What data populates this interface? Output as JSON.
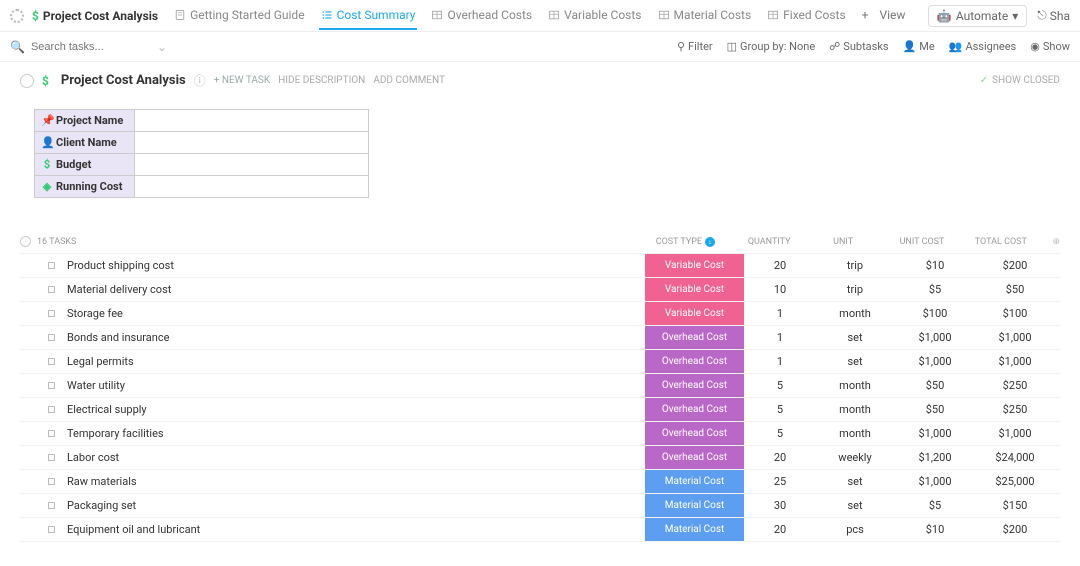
{
  "topbar": {
    "workspace_title": "Project Cost Analysis",
    "tabs": [
      {
        "label": "Getting Started Guide",
        "type": "doc"
      },
      {
        "label": "Cost Summary",
        "type": "list",
        "active": true
      },
      {
        "label": "Overhead Costs",
        "type": "table"
      },
      {
        "label": "Variable Costs",
        "type": "table"
      },
      {
        "label": "Material Costs",
        "type": "table"
      },
      {
        "label": "Fixed Costs",
        "type": "table"
      }
    ],
    "view_label": "View",
    "automate_label": "Automate",
    "share_label": "Sha"
  },
  "toolbar": {
    "search_placeholder": "Search tasks...",
    "filter": "Filter",
    "groupby": "Group by: None",
    "subtasks": "Subtasks",
    "me": "Me",
    "assignees": "Assignees",
    "show": "Show"
  },
  "page": {
    "title": "Project Cost Analysis",
    "new_task": "+ NEW TASK",
    "hide_desc": "HIDE DESCRIPTION",
    "add_comment": "ADD COMMENT",
    "show_closed": "SHOW CLOSED"
  },
  "fields": [
    {
      "icon": "📌",
      "icon_color": "#e74c3c",
      "label": "Project Name"
    },
    {
      "icon": "👤",
      "icon_color": "#d35400",
      "label": "Client Name"
    },
    {
      "icon": "$",
      "icon_color": "#2ecc71",
      "label": "Budget"
    },
    {
      "icon": "◈",
      "icon_color": "#2ecc71",
      "label": "Running Cost"
    }
  ],
  "table": {
    "count_label": "16 TASKS",
    "columns": {
      "cost_type": "COST TYPE",
      "quantity": "QUANTITY",
      "unit": "UNIT",
      "unit_cost": "UNIT COST",
      "total_cost": "TOTAL COST"
    },
    "rows": [
      {
        "name": "Product shipping cost",
        "cost_type": "Variable Cost",
        "type_class": "variable",
        "qty": "20",
        "unit": "trip",
        "unit_cost": "$10",
        "total": "$200"
      },
      {
        "name": "Material delivery cost",
        "cost_type": "Variable Cost",
        "type_class": "variable",
        "qty": "10",
        "unit": "trip",
        "unit_cost": "$5",
        "total": "$50"
      },
      {
        "name": "Storage fee",
        "cost_type": "Variable Cost",
        "type_class": "variable",
        "qty": "1",
        "unit": "month",
        "unit_cost": "$100",
        "total": "$100"
      },
      {
        "name": "Bonds and insurance",
        "cost_type": "Overhead Cost",
        "type_class": "overhead",
        "qty": "1",
        "unit": "set",
        "unit_cost": "$1,000",
        "total": "$1,000"
      },
      {
        "name": "Legal permits",
        "cost_type": "Overhead Cost",
        "type_class": "overhead",
        "qty": "1",
        "unit": "set",
        "unit_cost": "$1,000",
        "total": "$1,000"
      },
      {
        "name": "Water utility",
        "cost_type": "Overhead Cost",
        "type_class": "overhead",
        "qty": "5",
        "unit": "month",
        "unit_cost": "$50",
        "total": "$250"
      },
      {
        "name": "Electrical supply",
        "cost_type": "Overhead Cost",
        "type_class": "overhead",
        "qty": "5",
        "unit": "month",
        "unit_cost": "$50",
        "total": "$250"
      },
      {
        "name": "Temporary facilities",
        "cost_type": "Overhead Cost",
        "type_class": "overhead",
        "qty": "5",
        "unit": "month",
        "unit_cost": "$1,000",
        "total": "$1,000"
      },
      {
        "name": "Labor cost",
        "cost_type": "Overhead Cost",
        "type_class": "overhead",
        "qty": "20",
        "unit": "weekly",
        "unit_cost": "$1,200",
        "total": "$24,000"
      },
      {
        "name": "Raw materials",
        "cost_type": "Material Cost",
        "type_class": "material",
        "qty": "25",
        "unit": "set",
        "unit_cost": "$1,000",
        "total": "$25,000"
      },
      {
        "name": "Packaging set",
        "cost_type": "Material Cost",
        "type_class": "material",
        "qty": "30",
        "unit": "set",
        "unit_cost": "$5",
        "total": "$150"
      },
      {
        "name": "Equipment oil and lubricant",
        "cost_type": "Material Cost",
        "type_class": "material",
        "qty": "20",
        "unit": "pcs",
        "unit_cost": "$10",
        "total": "$200"
      }
    ]
  }
}
